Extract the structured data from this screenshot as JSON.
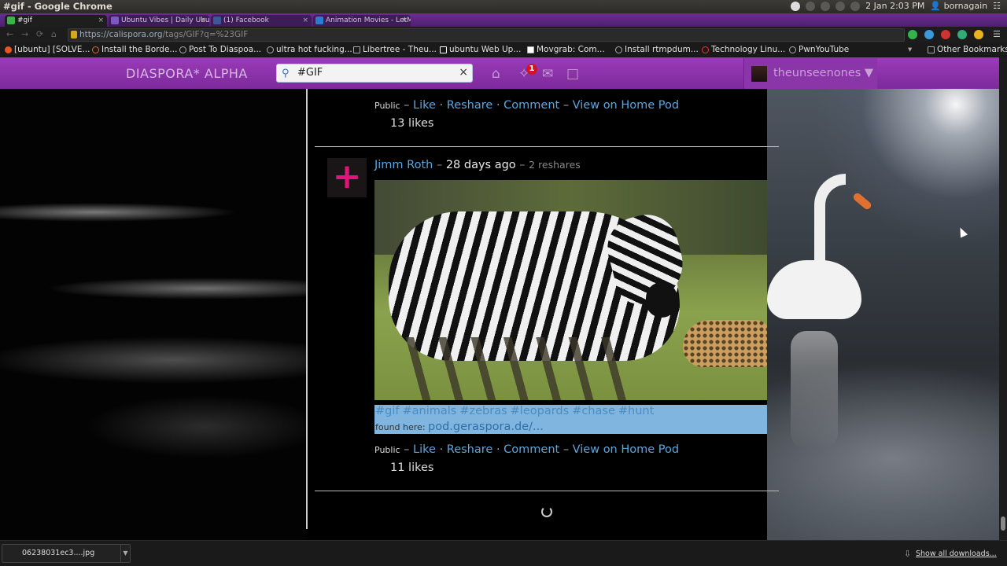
{
  "os": {
    "window_title": "#gif - Google Chrome",
    "clock": "2 Jan  2:03 PM",
    "user": "bornagain"
  },
  "tabs": [
    {
      "label": "#gif",
      "active": true,
      "favicon_color": "#3bb34a"
    },
    {
      "label": "Ubuntu Vibes | Daily Ubu...",
      "active": false,
      "favicon_color": "#7e57c2"
    },
    {
      "label": "(1) Facebook",
      "active": false,
      "favicon_color": "#3b5998"
    },
    {
      "label": "Animation Movies - LetM...",
      "active": false,
      "favicon_color": "#2b7bd1"
    }
  ],
  "omnibox": {
    "url_host": "https://calispora.org",
    "url_path": "/tags/GIF?q=%23GIF"
  },
  "bookmarks": [
    "[ubuntu] [SOLVE...",
    "Install the Borde...",
    "Post To Diaspoa...",
    "ultra hot fucking...",
    "Libertree - Theu...",
    "ubuntu Web Up...",
    "Movgrab: Com...",
    "Install rtmpdum...",
    "Technology Linu...",
    "PwnYouTube"
  ],
  "bookmarks_other": "Other Bookmarks",
  "diaspora": {
    "brand": "DIASPORA* ALPHA",
    "search_value": "#GIF",
    "notification_count": "1",
    "username": "theunseenones ▼",
    "accent": "#9b3bb8"
  },
  "post1": {
    "visibility": "Public",
    "like": "Like",
    "reshare": "Reshare",
    "comment": "Comment",
    "view": "View on Home Pod",
    "likes": "13 likes"
  },
  "post2": {
    "author": "Jimm Roth",
    "time": "28 days ago",
    "reshares": "2 reshares",
    "tags": [
      "#gif",
      "#animals",
      "#zebras",
      "#leopards",
      "#chase",
      "#hunt"
    ],
    "found_label": "found here:",
    "found_link": "pod.geraspora.de/...",
    "visibility": "Public",
    "like": "Like",
    "reshare": "Reshare",
    "comment": "Comment",
    "view": "View on Home Pod",
    "likes": "11 likes"
  },
  "downloads": {
    "file": "06238031ec3....jpg",
    "show_all": "Show all downloads..."
  }
}
